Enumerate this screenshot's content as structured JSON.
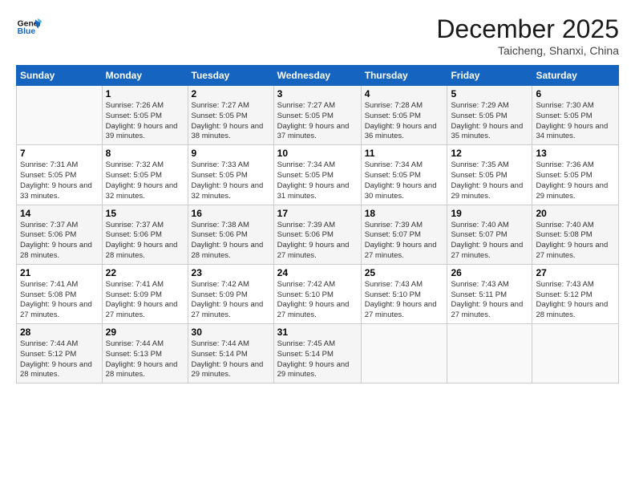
{
  "header": {
    "logo_line1": "General",
    "logo_line2": "Blue",
    "month": "December 2025",
    "location": "Taicheng, Shanxi, China"
  },
  "weekdays": [
    "Sunday",
    "Monday",
    "Tuesday",
    "Wednesday",
    "Thursday",
    "Friday",
    "Saturday"
  ],
  "weeks": [
    [
      {
        "day": "",
        "content": ""
      },
      {
        "day": "1",
        "content": "Sunrise: 7:26 AM\nSunset: 5:05 PM\nDaylight: 9 hours\nand 39 minutes."
      },
      {
        "day": "2",
        "content": "Sunrise: 7:27 AM\nSunset: 5:05 PM\nDaylight: 9 hours\nand 38 minutes."
      },
      {
        "day": "3",
        "content": "Sunrise: 7:27 AM\nSunset: 5:05 PM\nDaylight: 9 hours\nand 37 minutes."
      },
      {
        "day": "4",
        "content": "Sunrise: 7:28 AM\nSunset: 5:05 PM\nDaylight: 9 hours\nand 36 minutes."
      },
      {
        "day": "5",
        "content": "Sunrise: 7:29 AM\nSunset: 5:05 PM\nDaylight: 9 hours\nand 35 minutes."
      },
      {
        "day": "6",
        "content": "Sunrise: 7:30 AM\nSunset: 5:05 PM\nDaylight: 9 hours\nand 34 minutes."
      }
    ],
    [
      {
        "day": "7",
        "content": "Sunrise: 7:31 AM\nSunset: 5:05 PM\nDaylight: 9 hours\nand 33 minutes."
      },
      {
        "day": "8",
        "content": "Sunrise: 7:32 AM\nSunset: 5:05 PM\nDaylight: 9 hours\nand 32 minutes."
      },
      {
        "day": "9",
        "content": "Sunrise: 7:33 AM\nSunset: 5:05 PM\nDaylight: 9 hours\nand 32 minutes."
      },
      {
        "day": "10",
        "content": "Sunrise: 7:34 AM\nSunset: 5:05 PM\nDaylight: 9 hours\nand 31 minutes."
      },
      {
        "day": "11",
        "content": "Sunrise: 7:34 AM\nSunset: 5:05 PM\nDaylight: 9 hours\nand 30 minutes."
      },
      {
        "day": "12",
        "content": "Sunrise: 7:35 AM\nSunset: 5:05 PM\nDaylight: 9 hours\nand 29 minutes."
      },
      {
        "day": "13",
        "content": "Sunrise: 7:36 AM\nSunset: 5:05 PM\nDaylight: 9 hours\nand 29 minutes."
      }
    ],
    [
      {
        "day": "14",
        "content": "Sunrise: 7:37 AM\nSunset: 5:06 PM\nDaylight: 9 hours\nand 28 minutes."
      },
      {
        "day": "15",
        "content": "Sunrise: 7:37 AM\nSunset: 5:06 PM\nDaylight: 9 hours\nand 28 minutes."
      },
      {
        "day": "16",
        "content": "Sunrise: 7:38 AM\nSunset: 5:06 PM\nDaylight: 9 hours\nand 28 minutes."
      },
      {
        "day": "17",
        "content": "Sunrise: 7:39 AM\nSunset: 5:06 PM\nDaylight: 9 hours\nand 27 minutes."
      },
      {
        "day": "18",
        "content": "Sunrise: 7:39 AM\nSunset: 5:07 PM\nDaylight: 9 hours\nand 27 minutes."
      },
      {
        "day": "19",
        "content": "Sunrise: 7:40 AM\nSunset: 5:07 PM\nDaylight: 9 hours\nand 27 minutes."
      },
      {
        "day": "20",
        "content": "Sunrise: 7:40 AM\nSunset: 5:08 PM\nDaylight: 9 hours\nand 27 minutes."
      }
    ],
    [
      {
        "day": "21",
        "content": "Sunrise: 7:41 AM\nSunset: 5:08 PM\nDaylight: 9 hours\nand 27 minutes."
      },
      {
        "day": "22",
        "content": "Sunrise: 7:41 AM\nSunset: 5:09 PM\nDaylight: 9 hours\nand 27 minutes."
      },
      {
        "day": "23",
        "content": "Sunrise: 7:42 AM\nSunset: 5:09 PM\nDaylight: 9 hours\nand 27 minutes."
      },
      {
        "day": "24",
        "content": "Sunrise: 7:42 AM\nSunset: 5:10 PM\nDaylight: 9 hours\nand 27 minutes."
      },
      {
        "day": "25",
        "content": "Sunrise: 7:43 AM\nSunset: 5:10 PM\nDaylight: 9 hours\nand 27 minutes."
      },
      {
        "day": "26",
        "content": "Sunrise: 7:43 AM\nSunset: 5:11 PM\nDaylight: 9 hours\nand 27 minutes."
      },
      {
        "day": "27",
        "content": "Sunrise: 7:43 AM\nSunset: 5:12 PM\nDaylight: 9 hours\nand 28 minutes."
      }
    ],
    [
      {
        "day": "28",
        "content": "Sunrise: 7:44 AM\nSunset: 5:12 PM\nDaylight: 9 hours\nand 28 minutes."
      },
      {
        "day": "29",
        "content": "Sunrise: 7:44 AM\nSunset: 5:13 PM\nDaylight: 9 hours\nand 28 minutes."
      },
      {
        "day": "30",
        "content": "Sunrise: 7:44 AM\nSunset: 5:14 PM\nDaylight: 9 hours\nand 29 minutes."
      },
      {
        "day": "31",
        "content": "Sunrise: 7:45 AM\nSunset: 5:14 PM\nDaylight: 9 hours\nand 29 minutes."
      },
      {
        "day": "",
        "content": ""
      },
      {
        "day": "",
        "content": ""
      },
      {
        "day": "",
        "content": ""
      }
    ]
  ]
}
